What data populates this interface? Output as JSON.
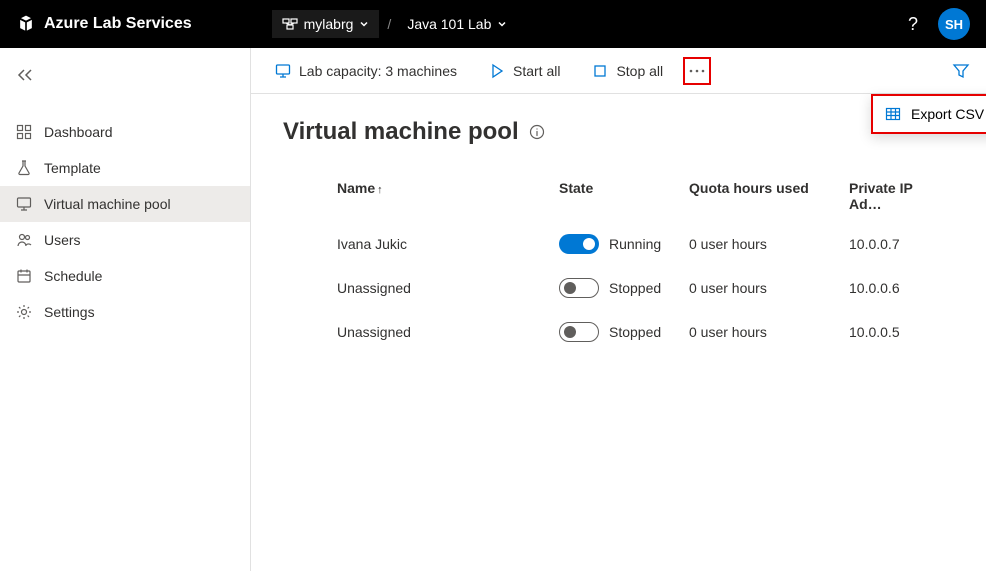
{
  "header": {
    "brand": "Azure Lab Services",
    "resource_group": "mylabrg",
    "lab": "Java 101 Lab",
    "separator": "/",
    "help": "?",
    "avatar_initials": "SH"
  },
  "sidebar": {
    "items": [
      {
        "label": "Dashboard",
        "icon": "dashboard"
      },
      {
        "label": "Template",
        "icon": "flask"
      },
      {
        "label": "Virtual machine pool",
        "icon": "monitor",
        "active": true
      },
      {
        "label": "Users",
        "icon": "users"
      },
      {
        "label": "Schedule",
        "icon": "calendar"
      },
      {
        "label": "Settings",
        "icon": "gear"
      }
    ]
  },
  "toolbar": {
    "capacity": "Lab capacity: 3 machines",
    "start": "Start all",
    "stop": "Stop all",
    "export_csv": "Export CSV"
  },
  "page": {
    "title": "Virtual machine pool"
  },
  "table": {
    "columns": {
      "name": "Name",
      "state": "State",
      "quota": "Quota hours used",
      "ip": "Private IP Ad…"
    },
    "rows": [
      {
        "name": "Ivana Jukic",
        "state": "Running",
        "quota": "0 user hours",
        "ip": "10.0.0.7",
        "on": true
      },
      {
        "name": "Unassigned",
        "state": "Stopped",
        "quota": "0 user hours",
        "ip": "10.0.0.6",
        "on": false
      },
      {
        "name": "Unassigned",
        "state": "Stopped",
        "quota": "0 user hours",
        "ip": "10.0.0.5",
        "on": false
      }
    ]
  }
}
